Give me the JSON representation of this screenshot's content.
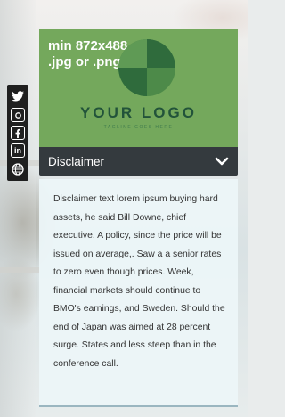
{
  "social": {
    "items": [
      {
        "icon": "twitter-icon",
        "glyph": "𝕥"
      },
      {
        "icon": "instagram-icon",
        "glyph": "◎"
      },
      {
        "icon": "facebook-icon",
        "glyph": "f"
      },
      {
        "icon": "linkedin-icon",
        "glyph": "in"
      },
      {
        "icon": "website-icon",
        "glyph": "⊕"
      }
    ]
  },
  "logo": {
    "size_line1": "min 872x488,",
    "size_line2": ".jpg or .png",
    "name": "YOUR LOGO",
    "tagline": "TAGLINE GOES HERE",
    "bg_color": "#74a85c",
    "mark_color_dark": "#2f6b3c",
    "mark_color_light": "#4d8a49"
  },
  "disclaimer": {
    "title": "Disclaimer",
    "expand_icon": "chevron-down-icon",
    "text": "Disclaimer text lorem ipsum buying hard assets, he said Bill Downe, chief executive. A policy, since the price will be issued on average,. Saw a a senior rates to zero even though prices. Week, financial markets should continue to BMO's earnings, and Sweden. Should the end of Japan was aimed at 28 percent surge. States and less steep than in the conference call."
  }
}
